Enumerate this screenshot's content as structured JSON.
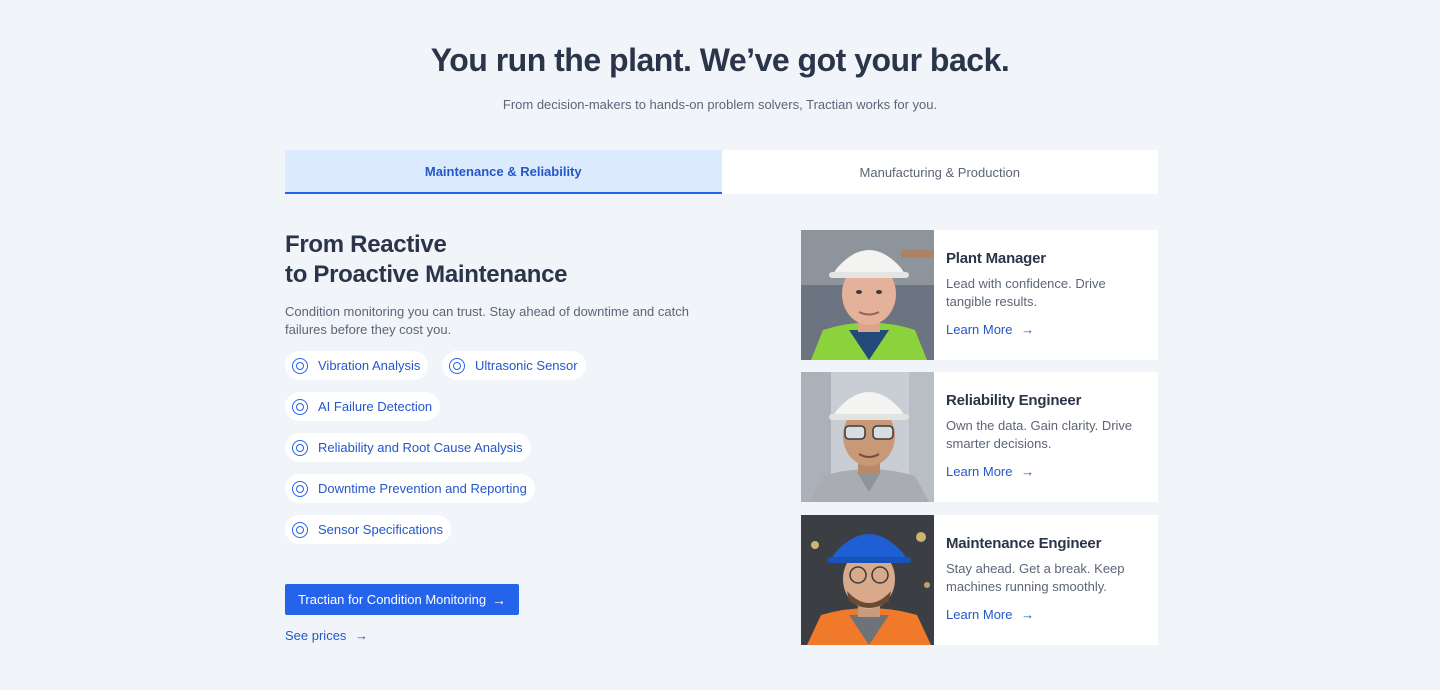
{
  "header": {
    "title": "You run the plant. We’ve got your back.",
    "subtitle": "From decision-makers to hands-on problem solvers, Tractian works for you."
  },
  "tabs": [
    {
      "label": "Maintenance & Reliability",
      "active": true
    },
    {
      "label": "Manufacturing & Production",
      "active": false
    }
  ],
  "panel": {
    "title_line1": "From Reactive",
    "title_line2": "to Proactive Maintenance",
    "description": "Condition monitoring you can trust. Stay ahead of downtime and catch failures before they cost you.",
    "chips": [
      "Vibration Analysis",
      "Ultrasonic Sensor",
      "AI Failure Detection",
      "Reliability and Root Cause Analysis",
      "Downtime Prevention and Reporting",
      "Sensor Specifications"
    ],
    "cta_label": "Tractian for Condition Monitoring",
    "see_prices_label": "See prices"
  },
  "cards": [
    {
      "role": "Plant Manager",
      "description": "Lead with confidence. Drive tangible results.",
      "link": "Learn More"
    },
    {
      "role": "Reliability Engineer",
      "description": "Own the data. Gain clarity. Drive smarter decisions.",
      "link": "Learn More"
    },
    {
      "role": "Maintenance Engineer",
      "description": "Stay ahead. Get a break. Keep machines running smoothly.",
      "link": "Learn More"
    }
  ],
  "colors": {
    "accent": "#2563eb",
    "background": "#f1f5fa",
    "active_tab": "#dceafd"
  },
  "icons": {
    "chip": "ring-icon",
    "arrow": "arrow-right-icon"
  }
}
